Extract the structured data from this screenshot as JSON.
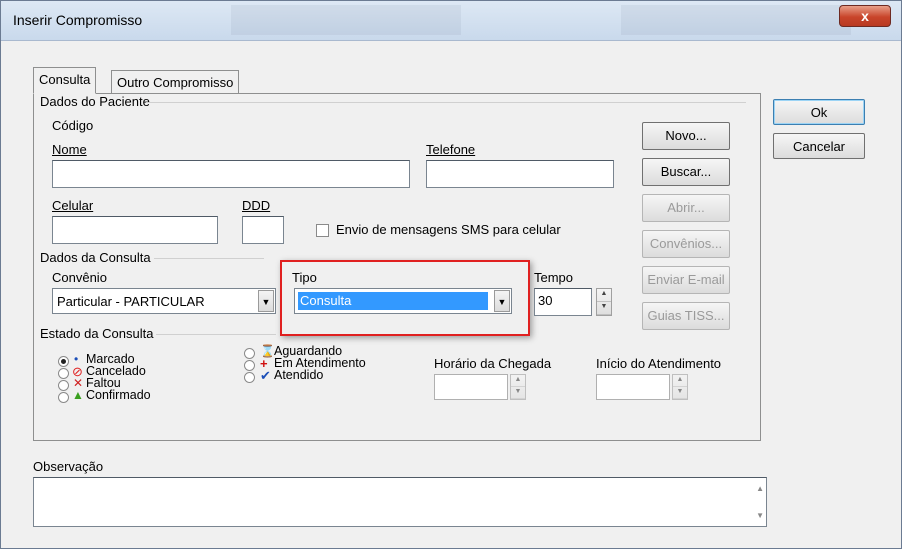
{
  "window": {
    "title": "Inserir Compromisso",
    "close_label": "x"
  },
  "tabs": [
    {
      "label": "Consulta"
    },
    {
      "label": "Outro Compromisso"
    }
  ],
  "paciente": {
    "group_title": "Dados do Paciente",
    "codigo_label": "Código",
    "nome_label": "Nome",
    "telefone_label": "Telefone",
    "celular_label": "Celular",
    "ddd_label": "DDD",
    "sms_label": "Envio de mensagens SMS para celular"
  },
  "side_buttons": [
    {
      "label": "Novo..."
    },
    {
      "label": "Buscar..."
    },
    {
      "label": "Abrir..."
    },
    {
      "label": "Convênios..."
    },
    {
      "label": "Enviar E-mail"
    },
    {
      "label": "Guias TISS..."
    }
  ],
  "dialog_buttons": {
    "ok": "Ok",
    "cancel": "Cancelar"
  },
  "consulta": {
    "group_title": "Dados da Consulta",
    "convenio_label": "Convênio",
    "convenio_value": "Particular - PARTICULAR",
    "tipo_label": "Tipo",
    "tipo_value": "Consulta",
    "tempo_label": "Tempo",
    "tempo_value": "30"
  },
  "estado": {
    "group_title": "Estado da Consulta",
    "options_left": [
      "Marcado",
      "Cancelado",
      "Faltou",
      "Confirmado"
    ],
    "options_right": [
      "Aguardando",
      "Em Atendimento",
      "Atendido"
    ],
    "horario_label": "Horário da Chegada",
    "inicio_label": "Início do Atendimento"
  },
  "observacao_label": "Observação",
  "colors": {
    "highlight": "#3399ff",
    "red_box": "#e02020"
  }
}
